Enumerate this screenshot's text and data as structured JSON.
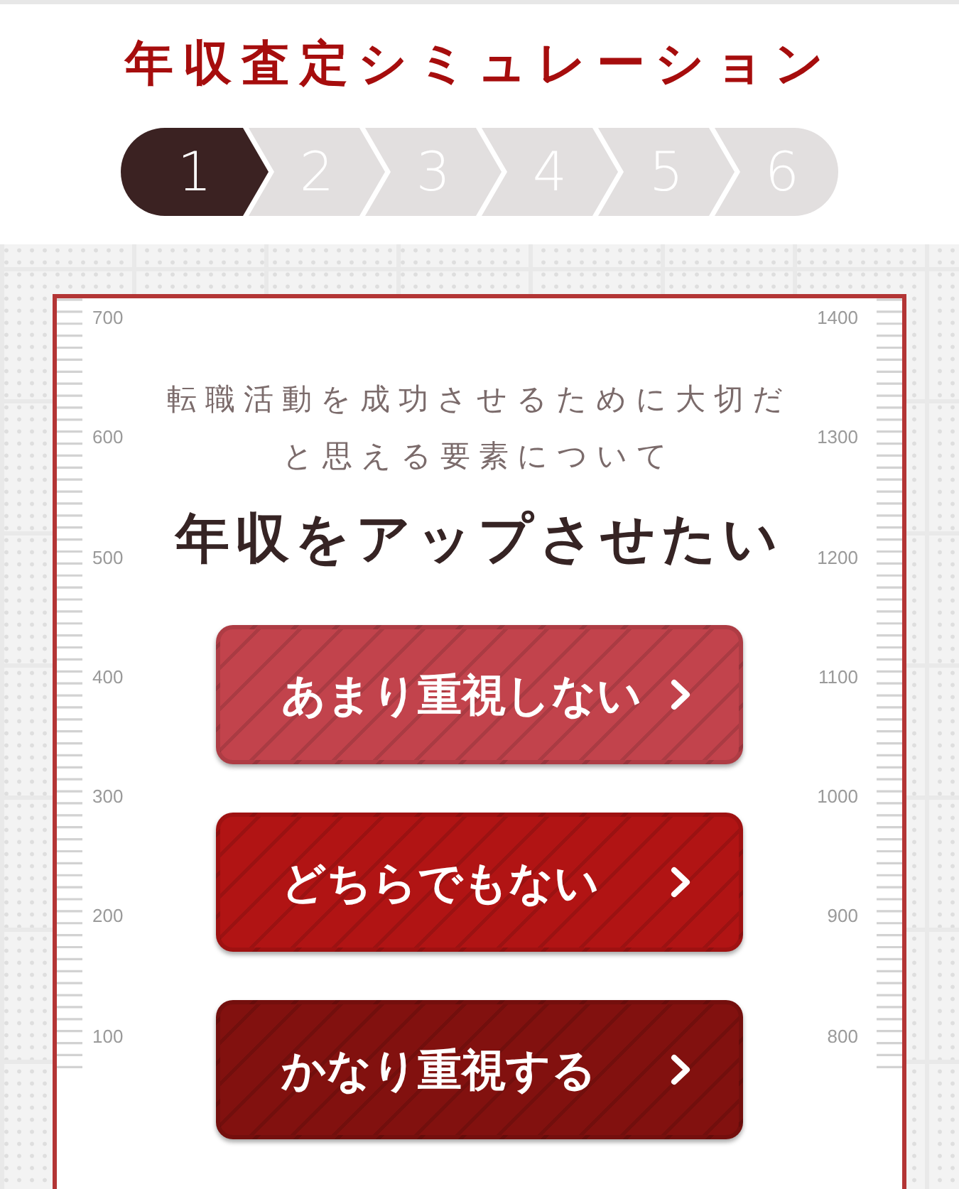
{
  "header": {
    "title": "年収査定シミュレーション"
  },
  "steps": [
    {
      "label": "1",
      "selected": true
    },
    {
      "label": "2",
      "selected": false
    },
    {
      "label": "3",
      "selected": false
    },
    {
      "label": "4",
      "selected": false
    },
    {
      "label": "5",
      "selected": false
    },
    {
      "label": "6",
      "selected": false
    }
  ],
  "card": {
    "left_scale": [
      "700",
      "600",
      "500",
      "400",
      "300",
      "200",
      "100"
    ],
    "right_scale": [
      "1400",
      "1300",
      "1200",
      "1100",
      "1000",
      "900",
      "800"
    ],
    "lead": "転職活動を成功させるために大切だと思える要素について",
    "topic": "年収をアップさせたい",
    "answers": [
      {
        "label": "あまり重視しない",
        "color": "#c2434c"
      },
      {
        "label": "どちらでもない",
        "color": "#b11414"
      },
      {
        "label": "かなり重視する",
        "color": "#82110f"
      }
    ]
  }
}
